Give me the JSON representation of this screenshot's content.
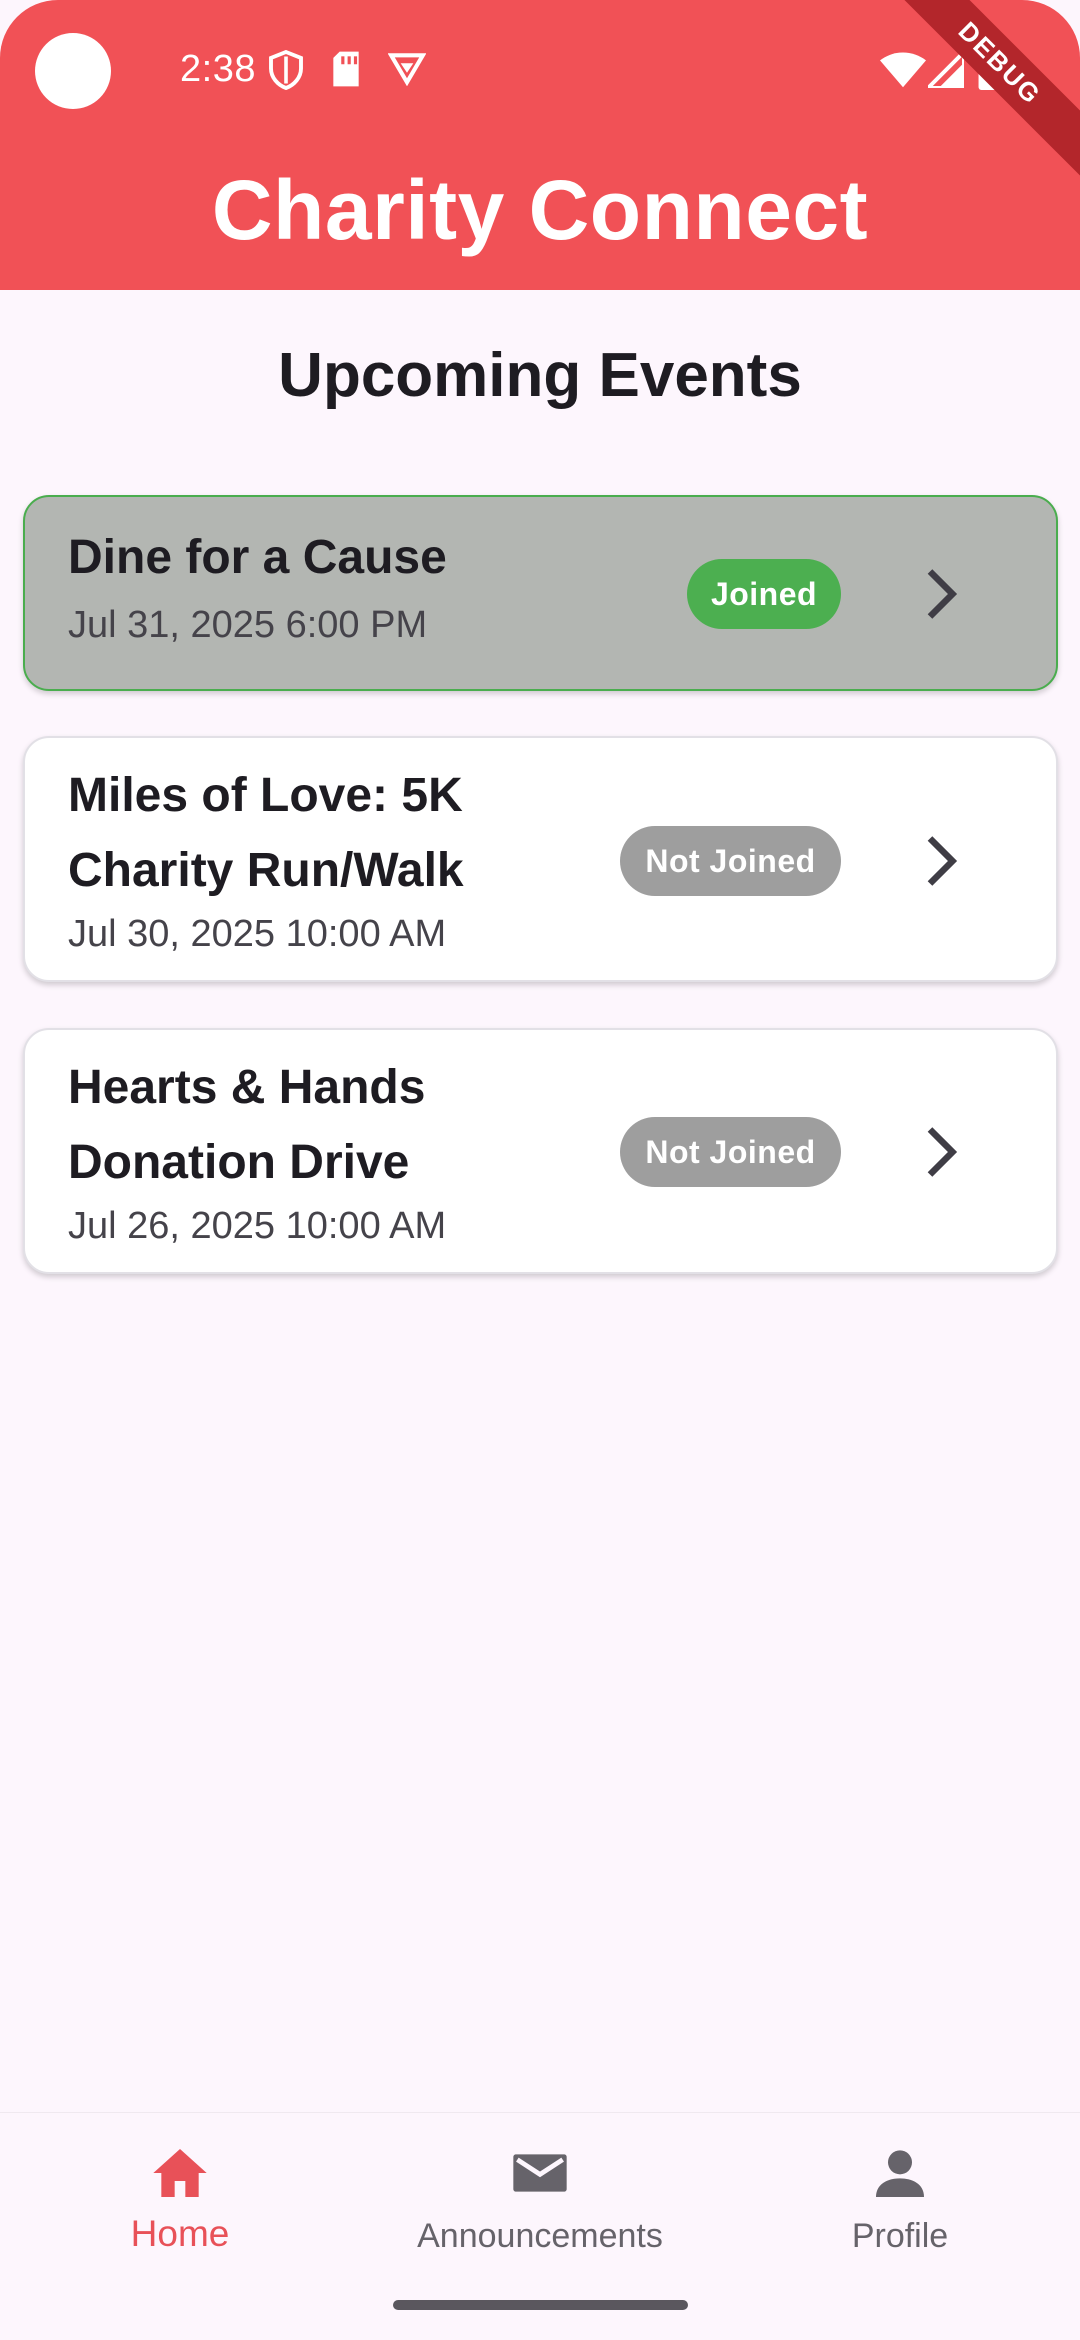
{
  "status_bar": {
    "time": "2:38",
    "icons": [
      "shield-icon",
      "sd-card-icon",
      "vpn-icon",
      "wifi-icon",
      "cell-signal-icon",
      "battery-icon"
    ]
  },
  "debug_banner": "DEBUG",
  "app_bar": {
    "title": "Charity Connect",
    "background": "#f15156"
  },
  "heading": "Upcoming Events",
  "events": [
    {
      "title": "Dine for a Cause",
      "date": "Jul 31, 2025 6:00 PM",
      "status": "Joined",
      "joined": true
    },
    {
      "title": "Miles of Love: 5K Charity Run/Walk",
      "date": "Jul 30, 2025 10:00 AM",
      "status": "Not Joined",
      "joined": false
    },
    {
      "title": "Hearts & Hands Donation Drive",
      "date": "Jul 26, 2025 10:00 AM",
      "status": "Not Joined",
      "joined": false
    }
  ],
  "colors": {
    "joined_badge": "#4caf50",
    "not_joined_badge": "#9e9e9e",
    "accent": "#e85158"
  },
  "bottom_nav": {
    "items": [
      {
        "label": "Home",
        "icon": "home-icon",
        "active": true
      },
      {
        "label": "Announcements",
        "icon": "mail-icon",
        "active": false
      },
      {
        "label": "Profile",
        "icon": "person-icon",
        "active": false
      }
    ]
  }
}
